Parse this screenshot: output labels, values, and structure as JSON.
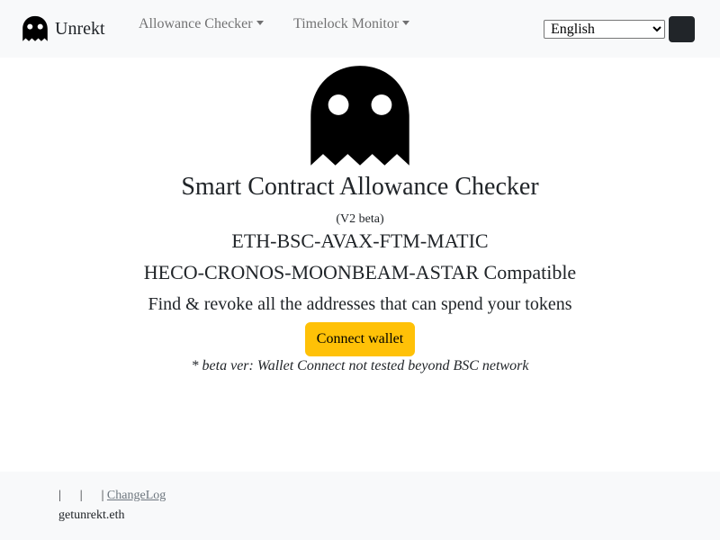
{
  "navbar": {
    "brand_name": "Unrekt",
    "brand_icon": "ghost-icon",
    "menus": [
      {
        "label": "Allowance Checker"
      },
      {
        "label": "Timelock Monitor"
      }
    ],
    "language": {
      "selected": "English"
    },
    "theme_toggle_color": "#212529"
  },
  "main": {
    "logo_icon": "ghost-icon",
    "title": "Smart Contract Allowance Checker",
    "version": "(V2 beta)",
    "chains_line1": "ETH-BSC-AVAX-FTM-MATIC",
    "chains_line2": "HECO-CRONOS-MOONBEAM-ASTAR Compatible",
    "tagline": "Find & revoke all the addresses that can spend your tokens",
    "connect_label": "Connect wallet",
    "connect_color": "#ffc107",
    "beta_note": "* beta ver: Wallet Connect not tested beyond BSC network"
  },
  "footer": {
    "separators": "|      |      |",
    "changelog_label": "ChangeLog",
    "ens": "getunrekt.eth"
  }
}
